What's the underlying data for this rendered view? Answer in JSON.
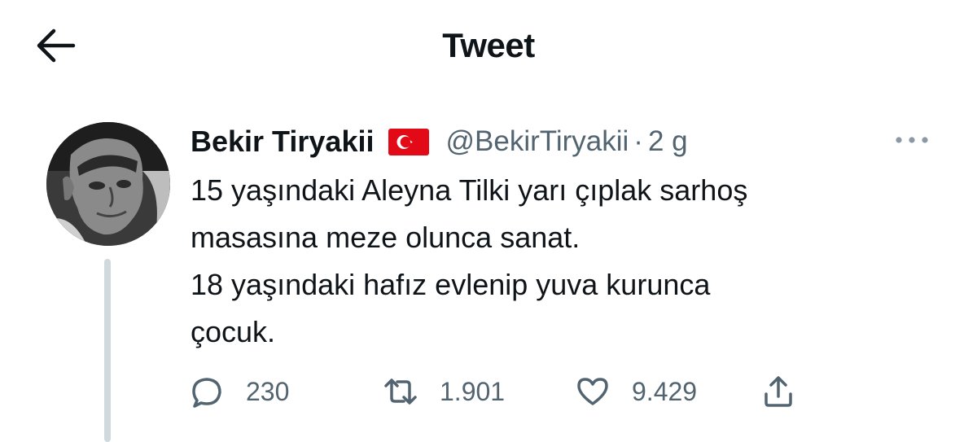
{
  "header": {
    "title": "Tweet",
    "back_icon": "arrow-left-icon"
  },
  "tweet": {
    "author": {
      "display_name": "Bekir Tiryakii",
      "flag_icon": "turkey-flag-icon",
      "handle": "@BekirTiryakii",
      "avatar_icon": "profile-photo"
    },
    "separator": "·",
    "time": "2 g",
    "more_icon": "more-horizontal-icon",
    "text_lines": [
      "15 yaşındaki Aleyna Tilki yarı çıplak sarhoş",
      "masasına meze olunca sanat.",
      "18 yaşındaki hafız evlenip yuva kurunca",
      "çocuk."
    ],
    "actions": {
      "reply": {
        "icon": "reply-icon",
        "count": "230"
      },
      "retweet": {
        "icon": "retweet-icon",
        "count": "1.901"
      },
      "like": {
        "icon": "heart-icon",
        "count": "9.429"
      },
      "share": {
        "icon": "share-icon"
      }
    }
  },
  "colors": {
    "text_primary": "#0f1419",
    "text_secondary": "#536471",
    "thread_line": "#cfd9de",
    "flag_red": "#e30a17"
  }
}
